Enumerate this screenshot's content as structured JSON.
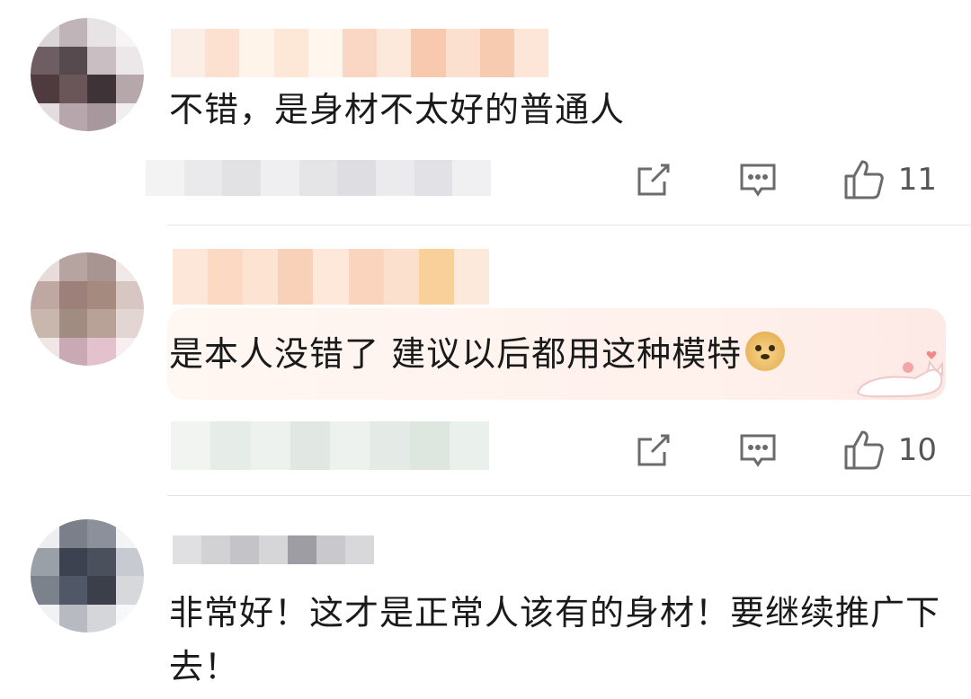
{
  "comments": [
    {
      "text": "不错，是身材不太好的普通人",
      "actions": {
        "share_icon": "share-icon",
        "reply_icon": "comment-icon",
        "like_icon": "thumbs-up-icon",
        "like_count": "11"
      }
    },
    {
      "text": "是本人没错了 建议以后都用这种模特",
      "emoji": "doge-emoji",
      "decoration": "cat-sticker",
      "actions": {
        "share_icon": "share-icon",
        "reply_icon": "comment-icon",
        "like_icon": "thumbs-up-icon",
        "like_count": "10"
      }
    },
    {
      "text": "非常好！这才是正常人该有的身材！要继续推广下去！"
    }
  ],
  "colors": {
    "text": "#1a1a1a",
    "icon": "#6b6b6b",
    "divider": "#e6e6e6",
    "bubble": "#fff4ee"
  }
}
